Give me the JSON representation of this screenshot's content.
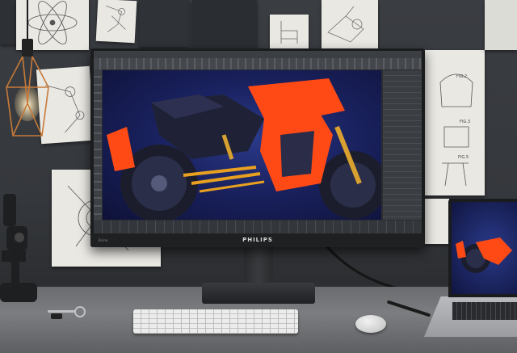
{
  "brand": {
    "monitor_logo": "PHILIPS",
    "model_label": "B-line"
  },
  "colors": {
    "wall": "#3a3d42",
    "desk": "#7b7d80",
    "bike_orange": "#ff4a16",
    "screen_blue": "#1a2260"
  },
  "icons": {
    "lamp": "pendant-lamp-icon",
    "microscope": "microscope-icon",
    "keys": "keys-icon"
  }
}
